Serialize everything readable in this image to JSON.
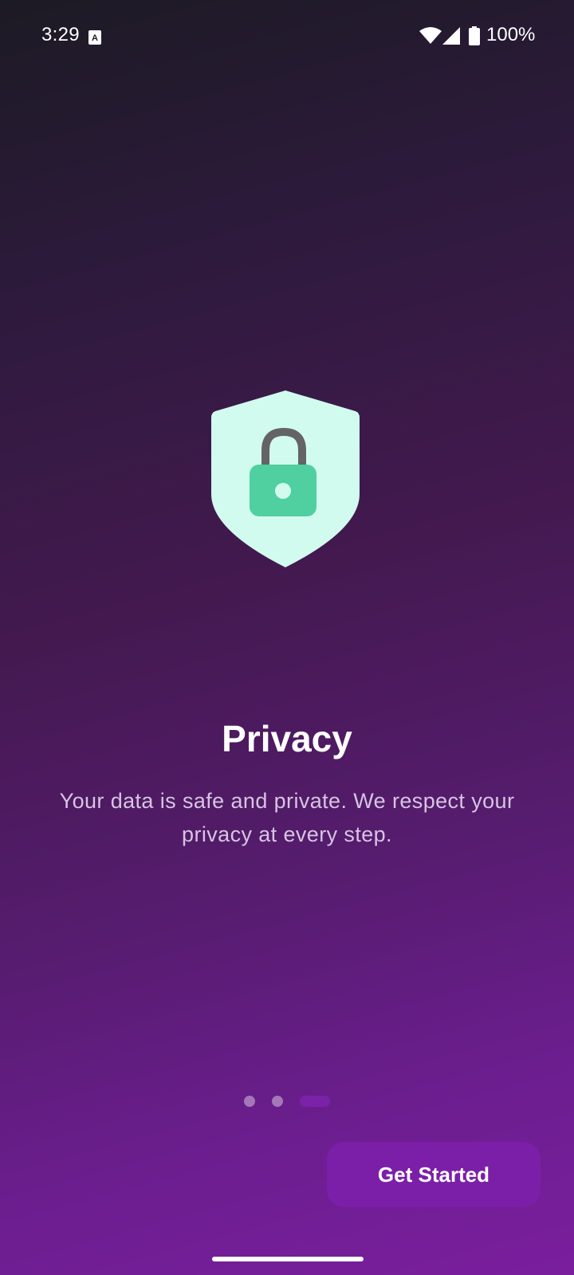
{
  "status_bar": {
    "time": "3:29",
    "battery_percent": "100%",
    "notification_icon": "a-icon",
    "wifi_icon": "wifi-icon",
    "signal_icon": "signal-icon",
    "battery_icon": "battery-icon"
  },
  "onboarding": {
    "illustration_icon": "shield-lock-icon",
    "title": "Privacy",
    "description": "Your data is safe and private. We respect your privacy at every step.",
    "page_indicator": {
      "total": 3,
      "current": 3
    },
    "primary_button_label": "Get Started"
  },
  "colors": {
    "shield_fill": "#d1fbef",
    "lock_body": "#50cfa0",
    "lock_shackle": "#646464",
    "button_bg": "#7b1fa9",
    "gradient_top": "#1c1a24",
    "gradient_bottom": "#7a1e9e"
  }
}
